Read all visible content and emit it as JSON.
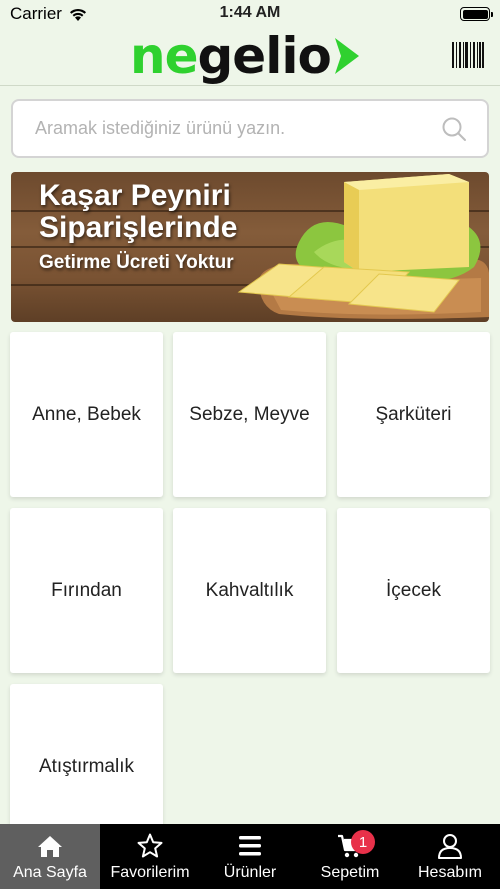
{
  "status_bar": {
    "carrier": "Carrier",
    "time": "1:44 AM"
  },
  "header": {
    "logo_part1": "ne",
    "logo_part2": "gelio",
    "brand_color": "#2fd12f"
  },
  "search": {
    "placeholder": "Aramak istediğiniz ürünü yazın.",
    "value": ""
  },
  "banner": {
    "title": "Kaşar Peyniri\nSiparişlerinde",
    "subtitle": "Getirme Ücreti Yoktur"
  },
  "categories": [
    {
      "label": "Anne, Bebek"
    },
    {
      "label": "Sebze, Meyve"
    },
    {
      "label": "Şarküteri"
    },
    {
      "label": "Fırından"
    },
    {
      "label": "Kahvaltılık"
    },
    {
      "label": "İçecek"
    },
    {
      "label": "Atıştırmalık"
    }
  ],
  "tabbar": {
    "tabs": [
      {
        "label": "Ana Sayfa",
        "icon": "home-icon",
        "active": true
      },
      {
        "label": "Favorilerim",
        "icon": "star-icon",
        "active": false
      },
      {
        "label": "Ürünler",
        "icon": "menu-icon",
        "active": false
      },
      {
        "label": "Sepetim",
        "icon": "cart-icon",
        "active": false,
        "badge": "1"
      },
      {
        "label": "Hesabım",
        "icon": "user-icon",
        "active": false
      }
    ],
    "badge_color": "#e8314a"
  }
}
